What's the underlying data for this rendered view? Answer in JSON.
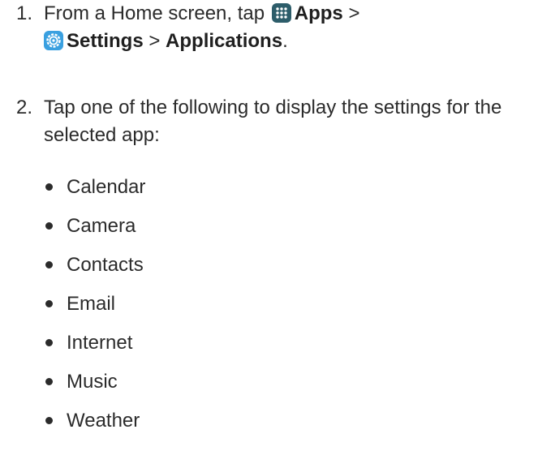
{
  "steps": [
    {
      "number": "1.",
      "text_a": "From a Home screen, tap",
      "apps_icon": "apps-grid-icon",
      "apps_label": "Apps",
      "sep1": ">",
      "settings_icon": "settings-gear-icon",
      "settings_label": "Settings",
      "sep2": ">",
      "applications_label": "Applications",
      "end": "."
    },
    {
      "number": "2.",
      "text": "Tap one of the following to display the settings for the selected app:"
    }
  ],
  "apps": [
    "Calendar",
    "Camera",
    "Contacts",
    "Email",
    "Internet",
    "Music",
    "Weather"
  ],
  "colors": {
    "apps_icon_bg": "#2d5d6a",
    "settings_icon_bg": "#3aa0e0",
    "text": "#2b2b2b"
  }
}
